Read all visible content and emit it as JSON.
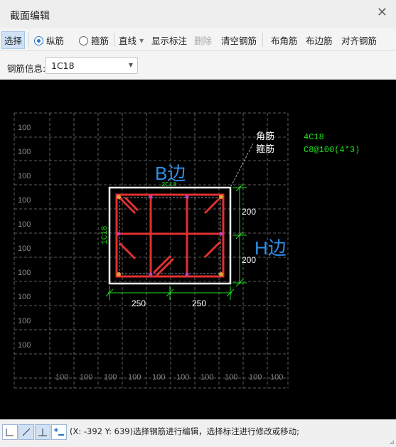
{
  "window": {
    "title": "截面编辑",
    "close_glyph": "✕"
  },
  "toolbar": {
    "select": "选择",
    "longitudinal": "纵筋",
    "stirrup": "箍筋",
    "line": "直线",
    "show_labels": "显示标注",
    "delete": "删除",
    "clear_rebar": "清空钢筋",
    "corner_rebar": "布角筋",
    "side_rebar": "布边筋",
    "align_rebar": "对齐钢筋"
  },
  "info": {
    "label": "钢筋信息:",
    "value": "1C18"
  },
  "canvas": {
    "grid_label": "100",
    "left_labels": [
      "100",
      "100",
      "100",
      "100",
      "100",
      "100",
      "100",
      "100",
      "100",
      "100"
    ],
    "bottom_labels": [
      "100",
      "100",
      "100",
      "100",
      "100",
      "100",
      "100",
      "100",
      "100",
      "100"
    ],
    "legend_corner": "角筋",
    "legend_stirrup": "箍筋",
    "corner_spec": "4C18",
    "stirrup_spec": "C8@100(4*3)",
    "b_side": "B边",
    "h_side": "H边",
    "side_top_label": "2C18",
    "side_left_label": "1C18",
    "dim_h1": "200",
    "dim_h2": "200",
    "dim_b1": "250",
    "dim_b2": "250"
  },
  "status": {
    "text": "(X: -392 Y: 639)选择钢筋进行编辑，选择标注进行修改或移动;",
    "corner": "⊿"
  },
  "colors": {
    "rebar_red": "#e23030",
    "dim_green": "#1fe01f",
    "label_blue": "#2f8fe6",
    "grid_gray": "#7a7a7a",
    "section_white": "#ffffff",
    "rebar_dot": "#c040c0"
  },
  "icons": {
    "close": "close-icon",
    "dropdown": "chevron-down-icon",
    "status_buttons": [
      "orthogonal-icon",
      "diagonal-line-icon",
      "perpendicular-icon",
      "add-remove-icon"
    ]
  }
}
